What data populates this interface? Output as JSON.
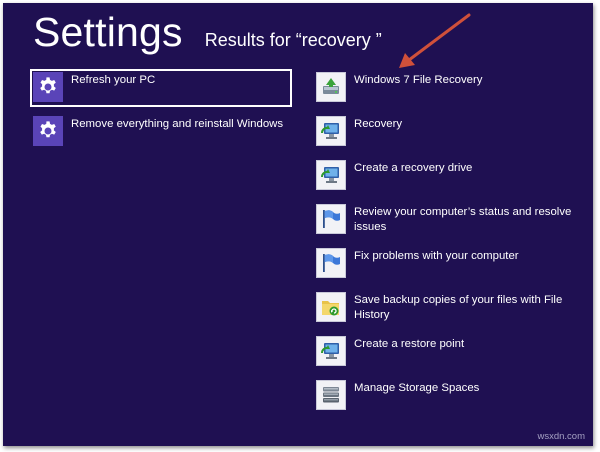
{
  "header": {
    "title": "Settings",
    "subtitle": "Results for “recovery ”"
  },
  "left_results": [
    {
      "label": "Refresh your PC",
      "icon": "gear-icon",
      "selected": true
    },
    {
      "label": "Remove everything and reinstall Windows",
      "icon": "gear-icon",
      "selected": false
    }
  ],
  "right_results": [
    {
      "label": "Windows 7 File Recovery",
      "icon": "file-recovery-icon"
    },
    {
      "label": "Recovery",
      "icon": "recovery-icon"
    },
    {
      "label": "Create a recovery drive",
      "icon": "recovery-drive-icon"
    },
    {
      "label": "Review your computer’s status and resolve issues",
      "icon": "action-center-flag-icon"
    },
    {
      "label": "Fix problems with your computer",
      "icon": "troubleshoot-flag-icon"
    },
    {
      "label": "Save backup copies of your files with File History",
      "icon": "file-history-icon"
    },
    {
      "label": "Create a restore point",
      "icon": "restore-point-icon"
    },
    {
      "label": "Manage Storage Spaces",
      "icon": "storage-spaces-icon"
    }
  ],
  "colors": {
    "background": "#1f1052",
    "gear_tile": "#5a44b8",
    "arrow": "#d0503a"
  },
  "watermark": "wsxdn.com"
}
